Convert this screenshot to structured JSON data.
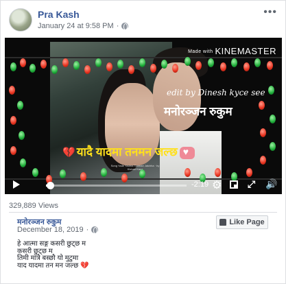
{
  "post": {
    "author": "Pra Kash",
    "timestamp": "January 24 at 9:58 PM",
    "separator": "·"
  },
  "video": {
    "watermark_prefix": "Made with",
    "watermark_brand": "KINEMASTER",
    "edit_credit": "edit by Dinesh kyce see",
    "title_overlay": "मनोरञ्जन रुकुम",
    "caption_overlay": "यादै यादमा तनमन जल्छ",
    "caption_prefix_icon": "broken-heart",
    "caption_suffix_icon": "heart-emoji",
    "time_remaining": "-2:19",
    "progress_fraction": 0.03,
    "small_print": "Song Yade Yadma Tanman Jalchha · by Kishan Kasa"
  },
  "stats": {
    "views": "329,889 Views"
  },
  "page_card": {
    "name": "मनोरञ्जन रुकुम",
    "date": "December 18, 2019",
    "like_label": "Like Page"
  },
  "lyrics": [
    "हे आत्मा सङ्ग कसरी छुट्छ म",
    "कसरी छुट्छ म",
    "तिमी मात्रै बस्छौ यो मुटुमा",
    "याद यादमा तन मन जल्छ"
  ],
  "icons": {
    "more": "more-dots-icon",
    "globe": "globe-icon",
    "play": "play-icon",
    "settings": "gear-icon",
    "miniplayer": "miniplayer-icon",
    "fullscreen": "fullscreen-icon",
    "volume": "volume-icon",
    "like": "thumbs-up-icon"
  },
  "colors": {
    "link": "#385898",
    "caption": "#ffe01b",
    "muted": "#606770"
  }
}
